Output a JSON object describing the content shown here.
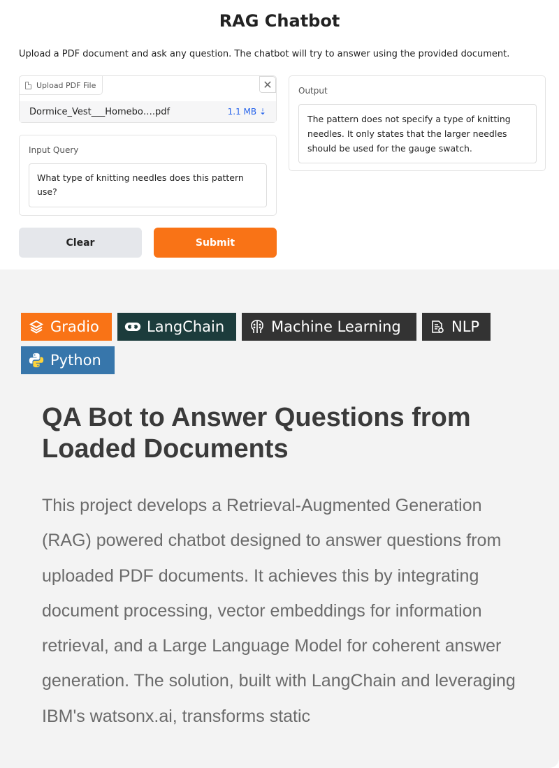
{
  "app": {
    "title": "RAG Chatbot",
    "description": "Upload a PDF document and ask any question. The chatbot will try to answer using the provided document.",
    "file_upload": {
      "label": "Upload PDF File",
      "file_name": "Dormice_Vest___Homebo….pdf",
      "file_size": "1.1 MB ⇣",
      "close_glyph": "✕"
    },
    "query": {
      "label": "Input Query",
      "value": "What type of knitting needles does this pattern use?"
    },
    "buttons": {
      "clear": "Clear",
      "submit": "Submit"
    },
    "output": {
      "label": "Output",
      "value": " The pattern does not specify a type of knitting needles. It only states that the larger needles should be used for the gauge swatch."
    },
    "colors": {
      "accent": "#f97316",
      "clear_bg": "#e5e7eb",
      "link": "#2563eb"
    }
  },
  "project": {
    "tags": [
      {
        "label": "Gradio",
        "icon": "gradio-icon",
        "color": "#f97316"
      },
      {
        "label": "LangChain",
        "icon": "langchain-icon",
        "color": "#1c3c3c"
      },
      {
        "label": "Machine Learning",
        "icon": "brain-icon",
        "color": "#333333"
      },
      {
        "label": "NLP",
        "icon": "nlp-icon",
        "color": "#333333"
      },
      {
        "label": "Python",
        "icon": "python-icon",
        "color": "#3776ab"
      }
    ],
    "title": "QA Bot to Answer Questions from Loaded Documents",
    "body": "This project develops a Retrieval-Augmented Generation (RAG) powered chatbot designed to answer questions from uploaded PDF documents. It achieves this by integrating document processing, vector embeddings for information retrieval, and a Large Language Model for coherent answer generation. The solution, built with LangChain and leveraging IBM's watsonx.ai, transforms static"
  }
}
